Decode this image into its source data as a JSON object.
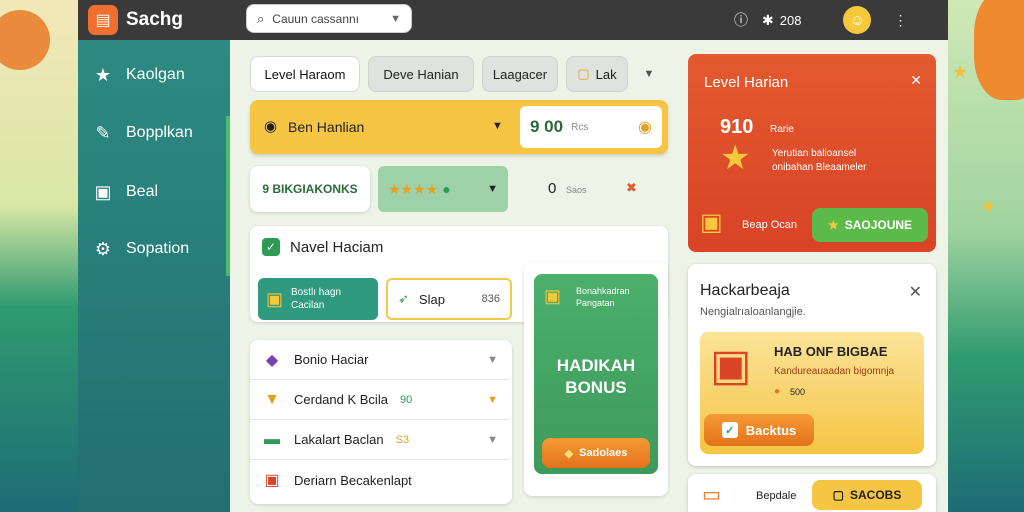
{
  "app": {
    "title": "Sachg"
  },
  "search": {
    "placeholder": "Cauun cassannı"
  },
  "topbar": {
    "points": "208"
  },
  "sidebar": {
    "items": [
      {
        "label": "Kaolgan",
        "icon": "star-icon"
      },
      {
        "label": "Bopplkan",
        "icon": "pencil-icon"
      },
      {
        "label": "Beal",
        "icon": "chat-icon"
      },
      {
        "label": "Sopation",
        "icon": "gear-icon"
      }
    ]
  },
  "tabs": [
    "Level Haraom",
    "Deve Hanian",
    "Laagacer",
    "Lak"
  ],
  "yellow_panel": {
    "label": "Ben Hanlian",
    "value": "9 00",
    "unit": "Rcs"
  },
  "row2": {
    "label": "9 BIKGIAKONKS",
    "value": "0",
    "unit": "Saos",
    "stars": 4
  },
  "level_card": {
    "title": "Navel Haciam",
    "teal_button": {
      "line1": "Bostlı hagn",
      "line2": "Cacilan"
    },
    "slap": {
      "label": "Slap",
      "value": "836"
    }
  },
  "list": [
    {
      "label": "Bonio Haciar",
      "icon": "gem-icon"
    },
    {
      "label": "Cerdand K Bcila",
      "value": "90",
      "icon": "cup-icon"
    },
    {
      "label": "Lakalart Baclan",
      "value": "S3",
      "icon": "hat-icon"
    },
    {
      "label": "Deriarn Becakenlapt",
      "icon": "gift-icon"
    }
  ],
  "bonus_card": {
    "subtitle1": "Bonahkadran",
    "subtitle2": "Pangatan",
    "title1": "HADIKAH",
    "title2": "BONUS",
    "button": "Sadolaes"
  },
  "red_card": {
    "title": "Level Harian",
    "value": "910",
    "unit": "Rarie",
    "desc1": "Yerutian balioansel",
    "desc2": "onibahan Bleaameler",
    "reward": "Beap Ocan",
    "button": "SAOJOUNE"
  },
  "white_card": {
    "title": "Hackarbeaja",
    "subtitle": "Nengialrıaloanlangjie.",
    "promo_title": "HAB ONF BIGBAE",
    "promo_sub": "Kandureauaadan bigomnja",
    "promo_value": "500",
    "button": "Backtus"
  },
  "bottom_card": {
    "label": "Bepdale",
    "button": "SACOBS"
  },
  "colors": {
    "accent": "#ef6f2f",
    "teal": "#2d8a82",
    "green": "#4caf6c",
    "yellow": "#f6c544",
    "red": "#e35a2f"
  }
}
